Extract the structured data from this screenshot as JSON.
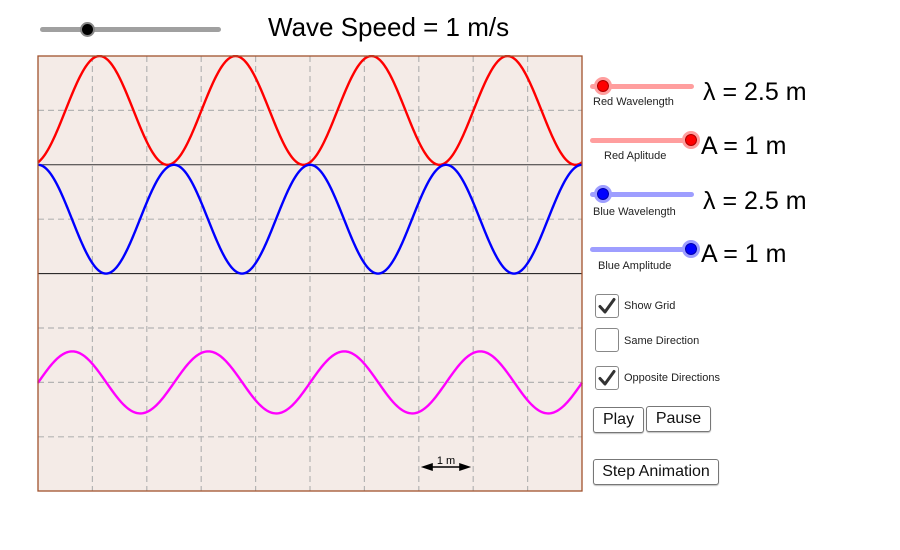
{
  "speed": {
    "label": "Wave Speed = 1 m/s",
    "value": 1,
    "min": 0,
    "max": 5,
    "track_color": "#a0a0a0",
    "knob_color": "#000000"
  },
  "sliders": [
    {
      "caption": "Red Wavelength",
      "readout": "λ = 2.5 m",
      "fraction": 0.1,
      "track_color": "#ff9e9e",
      "knob_color": "#ff0000"
    },
    {
      "caption": "Red Aplitude",
      "readout": "A = 1 m",
      "fraction": 1.0,
      "track_color": "#ff9e9e",
      "knob_color": "#ff0000"
    },
    {
      "caption": "Blue Wavelength",
      "readout": "λ = 2.5 m",
      "fraction": 0.1,
      "track_color": "#9e9eff",
      "knob_color": "#0000ff"
    },
    {
      "caption": "Blue Amplitude",
      "readout": "A = 1 m",
      "fraction": 1.0,
      "track_color": "#9e9eff",
      "knob_color": "#0000ff"
    }
  ],
  "checkboxes": [
    {
      "label": "Show Grid",
      "checked": true
    },
    {
      "label": "Same Direction",
      "checked": false
    },
    {
      "label": "Opposite Directions",
      "checked": true
    }
  ],
  "buttons": {
    "play": "Play",
    "pause": "Pause",
    "step": "Step Animation"
  },
  "plot": {
    "background": "#f4ebe7",
    "border": "#a0522d",
    "grid_color": "#b4b4b4",
    "scale_label": "1 m",
    "width_m": 10,
    "waves": [
      {
        "name": "red",
        "color": "#ff0000",
        "wavelength_m": 2.5,
        "amplitude_m": 1,
        "peak_at_m": 1.13,
        "baseline": "min"
      },
      {
        "name": "blue",
        "color": "#0000ff",
        "wavelength_m": 2.5,
        "amplitude_m": 1,
        "peak_at_m": 0.0,
        "baseline": "max"
      },
      {
        "name": "superposition",
        "color": "#ff00ff",
        "wavelength_m": 2.5,
        "amplitude_m": 0.57,
        "peak_at_m": 0.63,
        "baseline": "center"
      }
    ]
  }
}
